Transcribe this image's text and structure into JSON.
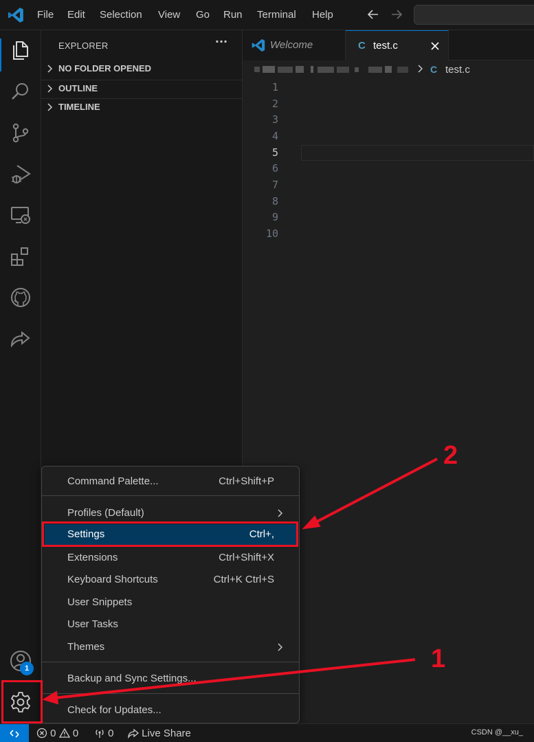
{
  "menubar": {
    "items": [
      "File",
      "Edit",
      "Selection",
      "View",
      "Go",
      "Run",
      "Terminal",
      "Help"
    ]
  },
  "sidebar": {
    "title": "EXPLORER",
    "more": "···",
    "sections": [
      "NO FOLDER OPENED",
      "OUTLINE",
      "TIMELINE"
    ]
  },
  "tabs": {
    "welcome": "Welcome",
    "active_icon": "C",
    "active": "test.c"
  },
  "breadcrumb": {
    "icon": "C",
    "file": "test.c"
  },
  "editor": {
    "line_numbers": [
      "1",
      "2",
      "3",
      "4",
      "5",
      "6",
      "7",
      "8",
      "9",
      "10"
    ],
    "active_line": "5"
  },
  "context_menu": {
    "command_palette": {
      "label": "Command Palette...",
      "shortcut": "Ctrl+Shift+P"
    },
    "profiles": {
      "label": "Profiles (Default)"
    },
    "settings": {
      "label": "Settings",
      "shortcut": "Ctrl+,"
    },
    "extensions": {
      "label": "Extensions",
      "shortcut": "Ctrl+Shift+X"
    },
    "keyboard_shortcuts": {
      "label": "Keyboard Shortcuts",
      "shortcut": "Ctrl+K Ctrl+S"
    },
    "user_snippets": {
      "label": "User Snippets"
    },
    "user_tasks": {
      "label": "User Tasks"
    },
    "themes": {
      "label": "Themes"
    },
    "backup_sync": {
      "label": "Backup and Sync Settings..."
    },
    "check_updates": {
      "label": "Check for Updates..."
    }
  },
  "activity": {
    "accounts_badge": "1"
  },
  "annotations": {
    "step1": "1",
    "step2": "2"
  },
  "statusbar": {
    "errors": "0",
    "warnings": "0",
    "ports": "0",
    "live_share": "Live Share",
    "watermark": "CSDN @__xu_"
  },
  "colors": {
    "accent": "#0078d4",
    "annotation_red": "#e81123",
    "selected_menu": "#04395e"
  }
}
